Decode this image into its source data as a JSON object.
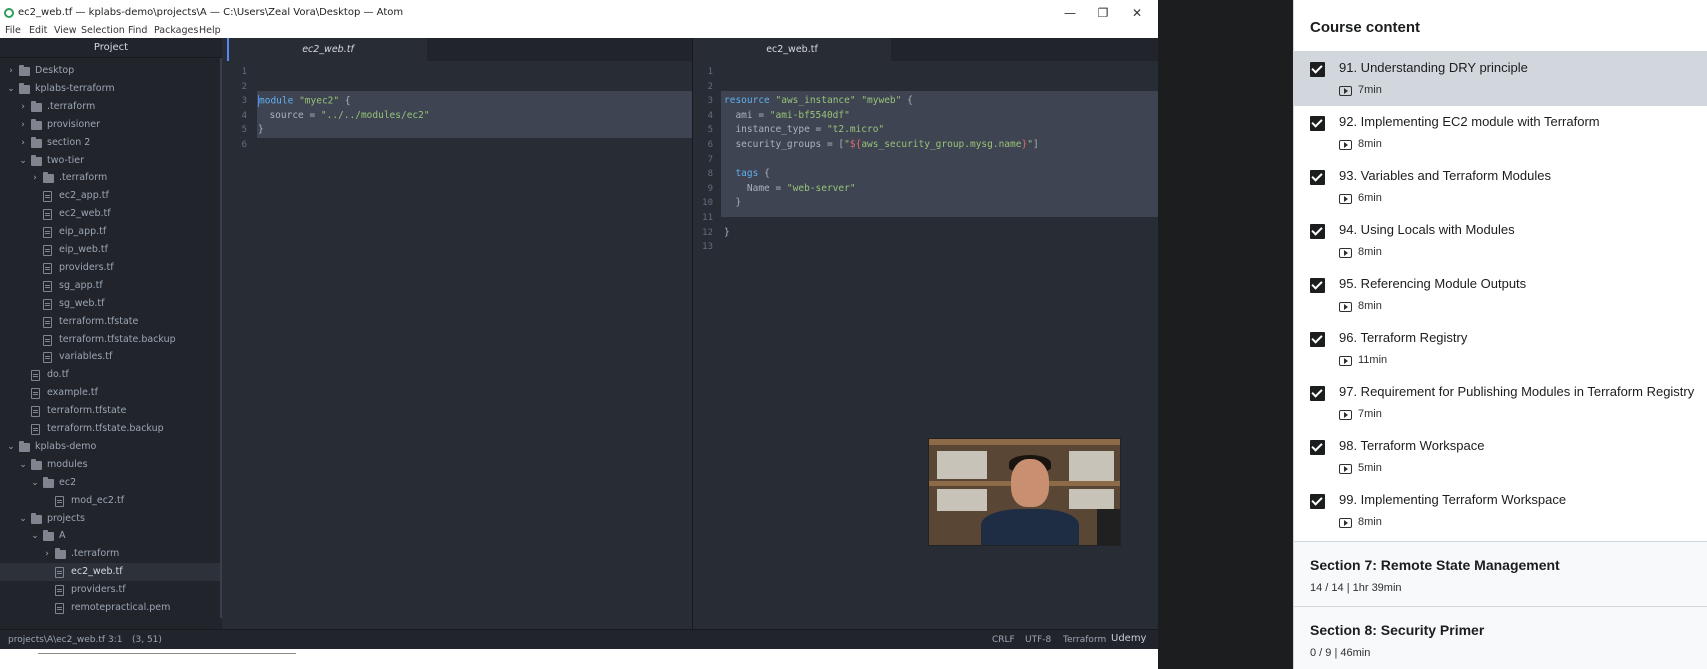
{
  "window": {
    "title": "ec2_web.tf — kplabs-demo\\projects\\A — C:\\Users\\Zeal Vora\\Desktop — Atom",
    "minimize": "—",
    "maximize": "❐",
    "close": "✕"
  },
  "menu": [
    "File",
    "Edit",
    "View",
    "Selection",
    "Find",
    "Packages",
    "Help"
  ],
  "tree": {
    "header": "Project",
    "items": [
      {
        "label": "Desktop",
        "type": "folder",
        "depth": 0,
        "expanded": false
      },
      {
        "label": "kplabs-terraform",
        "type": "folder",
        "depth": 0,
        "expanded": true
      },
      {
        "label": ".terraform",
        "type": "folder",
        "depth": 1,
        "expanded": false
      },
      {
        "label": "provisioner",
        "type": "folder",
        "depth": 1,
        "expanded": false
      },
      {
        "label": "section 2",
        "type": "folder",
        "depth": 1,
        "expanded": false
      },
      {
        "label": "two-tier",
        "type": "folder",
        "depth": 1,
        "expanded": true
      },
      {
        "label": ".terraform",
        "type": "folder",
        "depth": 2,
        "expanded": false
      },
      {
        "label": "ec2_app.tf",
        "type": "file",
        "depth": 2
      },
      {
        "label": "ec2_web.tf",
        "type": "file",
        "depth": 2
      },
      {
        "label": "eip_app.tf",
        "type": "file",
        "depth": 2
      },
      {
        "label": "eip_web.tf",
        "type": "file",
        "depth": 2
      },
      {
        "label": "providers.tf",
        "type": "file",
        "depth": 2
      },
      {
        "label": "sg_app.tf",
        "type": "file",
        "depth": 2
      },
      {
        "label": "sg_web.tf",
        "type": "file",
        "depth": 2
      },
      {
        "label": "terraform.tfstate",
        "type": "file",
        "depth": 2
      },
      {
        "label": "terraform.tfstate.backup",
        "type": "file",
        "depth": 2
      },
      {
        "label": "variables.tf",
        "type": "file",
        "depth": 2
      },
      {
        "label": "do.tf",
        "type": "file",
        "depth": 1
      },
      {
        "label": "example.tf",
        "type": "file",
        "depth": 1
      },
      {
        "label": "terraform.tfstate",
        "type": "file",
        "depth": 1
      },
      {
        "label": "terraform.tfstate.backup",
        "type": "file",
        "depth": 1
      },
      {
        "label": "kplabs-demo",
        "type": "folder",
        "depth": 0,
        "expanded": true
      },
      {
        "label": "modules",
        "type": "folder",
        "depth": 1,
        "expanded": true
      },
      {
        "label": "ec2",
        "type": "folder",
        "depth": 2,
        "expanded": true
      },
      {
        "label": "mod_ec2.tf",
        "type": "file",
        "depth": 3
      },
      {
        "label": "projects",
        "type": "folder",
        "depth": 1,
        "expanded": true
      },
      {
        "label": "A",
        "type": "folder",
        "depth": 2,
        "expanded": true
      },
      {
        "label": ".terraform",
        "type": "folder",
        "depth": 3,
        "expanded": false
      },
      {
        "label": "ec2_web.tf",
        "type": "file",
        "depth": 3,
        "selected": true
      },
      {
        "label": "providers.tf",
        "type": "file",
        "depth": 3
      },
      {
        "label": "remotepractical.pem",
        "type": "file",
        "depth": 3
      }
    ]
  },
  "left_pane": {
    "tab": "ec2_web.tf",
    "line_numbers": [
      "1",
      "2",
      "3",
      "4",
      "5",
      "6"
    ],
    "lines": [
      "",
      "",
      "module \"myec2\" {",
      "  source = \"../../modules/ec2\"",
      "}",
      ""
    ]
  },
  "right_pane": {
    "tab": "ec2_web.tf",
    "line_numbers": [
      "1",
      "2",
      "3",
      "4",
      "5",
      "6",
      "7",
      "8",
      "9",
      "10",
      "11",
      "12",
      "13"
    ],
    "lines": [
      "",
      "",
      "resource \"aws_instance\" \"myweb\" {",
      "  ami = \"ami-bf5540df\"",
      "  instance_type = \"t2.micro\"",
      "  security_groups = [\"${aws_security_group.mysg.name}\"]",
      "",
      "  tags {",
      "    Name = \"web-server\"",
      "  }",
      "",
      "}",
      ""
    ]
  },
  "statusbar": {
    "path": "projects\\A\\ec2_web.tf",
    "cursor": "3:1",
    "selection": "(3, 51)",
    "line_ending": "CRLF",
    "encoding": "UTF-8",
    "grammar": "Terraform",
    "watermark": "Udemy"
  },
  "course": {
    "header": "Course content",
    "lectures": [
      {
        "title": "91. Understanding DRY principle",
        "duration": "7min",
        "current": true
      },
      {
        "title": "92. Implementing EC2 module with Terraform",
        "duration": "8min"
      },
      {
        "title": "93. Variables and Terraform Modules",
        "duration": "6min"
      },
      {
        "title": "94. Using Locals with Modules",
        "duration": "8min"
      },
      {
        "title": "95. Referencing Module Outputs",
        "duration": "8min"
      },
      {
        "title": "96. Terraform Registry",
        "duration": "11min"
      },
      {
        "title": "97. Requirement for Publishing Modules in Terraform Registry",
        "duration": "7min"
      },
      {
        "title": "98. Terraform Workspace",
        "duration": "5min"
      },
      {
        "title": "99. Implementing Terraform Workspace",
        "duration": "8min"
      }
    ],
    "sections": [
      {
        "title": "Section 7: Remote State Management",
        "meta": "14 / 14 | 1hr 39min"
      },
      {
        "title": "Section 8: Security Primer",
        "meta": "0 / 9 | 46min"
      }
    ]
  }
}
